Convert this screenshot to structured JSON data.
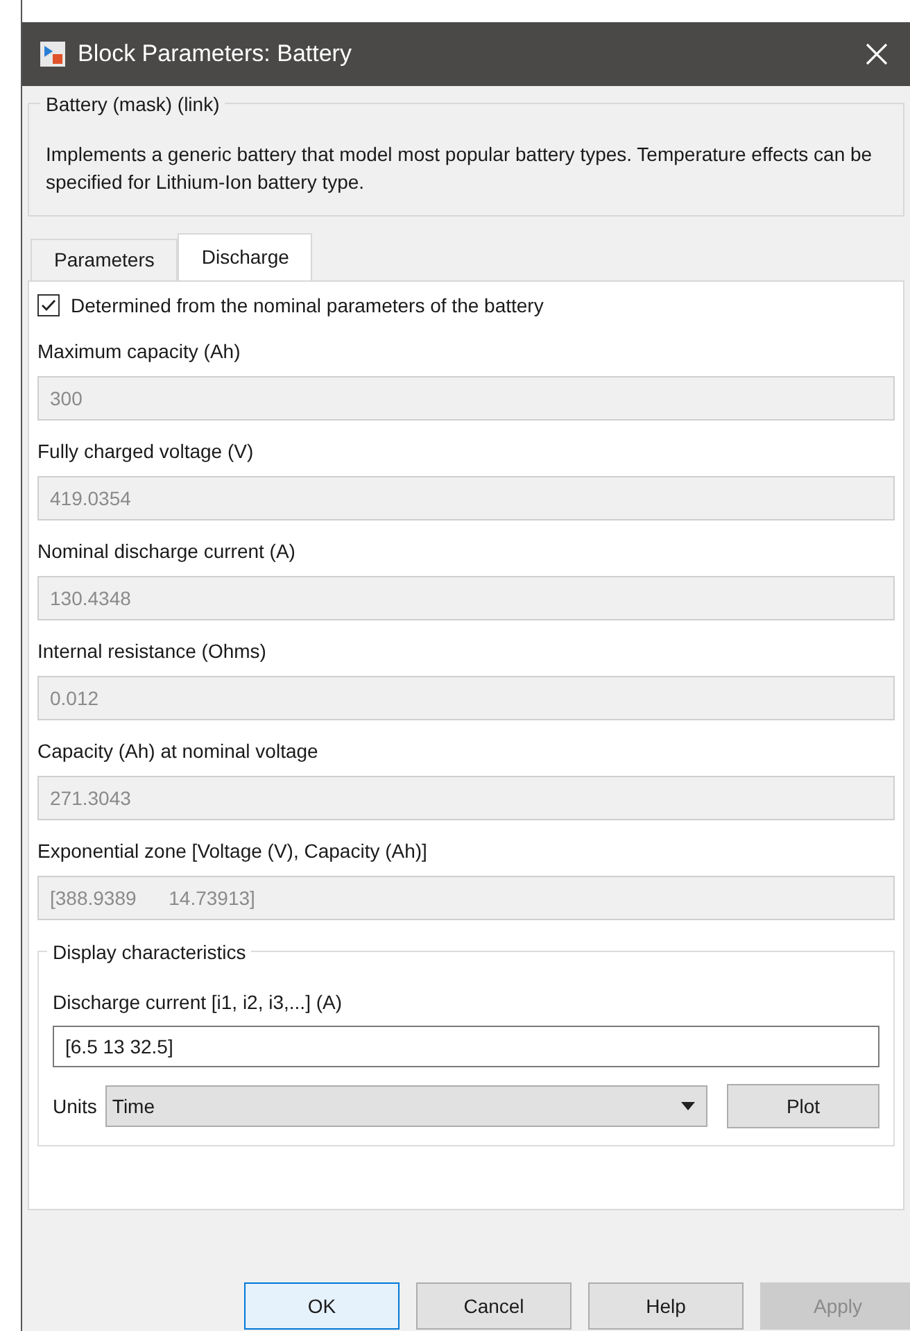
{
  "window": {
    "title": "Block Parameters: Battery"
  },
  "mask": {
    "title": "Battery (mask) (link)",
    "description": "Implements a generic battery that model most popular battery types. Temperature effects can be specified for Lithium-Ion battery type."
  },
  "tabs": [
    {
      "label": "Parameters",
      "selected": false
    },
    {
      "label": "Discharge",
      "selected": true
    }
  ],
  "checkbox": {
    "label": "Determined from the nominal parameters of the battery",
    "checked": true
  },
  "parameters": [
    {
      "label": "Maximum capacity (Ah)",
      "value": "300",
      "disabled": true
    },
    {
      "label": "Fully charged voltage (V)",
      "value": "419.0354",
      "disabled": true
    },
    {
      "label": "Nominal discharge current (A)",
      "value": "130.4348",
      "disabled": true
    },
    {
      "label": "Internal resistance (Ohms)",
      "value": "0.012",
      "disabled": true
    },
    {
      "label": "Capacity (Ah) at nominal voltage",
      "value": "271.3043",
      "disabled": true
    },
    {
      "label": "Exponential zone [Voltage (V), Capacity (Ah)]",
      "value": "[388.9389      14.73913]",
      "disabled": true
    }
  ],
  "display": {
    "title": "Display characteristics",
    "current_label": "Discharge current [i1, i2, i3,...] (A)",
    "current_value": "[6.5 13 32.5]",
    "units_label": "Units",
    "units_value": "Time",
    "plot": "Plot"
  },
  "buttons": [
    {
      "label": "OK",
      "selected": true,
      "disabled": false
    },
    {
      "label": "Cancel",
      "selected": false,
      "disabled": false
    },
    {
      "label": "Help",
      "selected": false,
      "disabled": false
    },
    {
      "label": "Apply",
      "selected": false,
      "disabled": true
    }
  ]
}
